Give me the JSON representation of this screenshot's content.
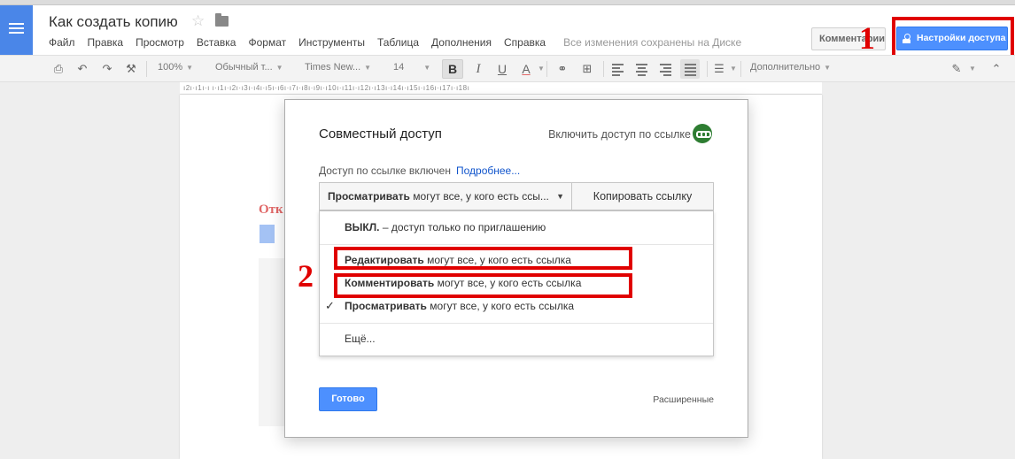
{
  "header": {
    "doc_title": "Как создать копию",
    "menu": [
      "Файл",
      "Правка",
      "Просмотр",
      "Вставка",
      "Формат",
      "Инструменты",
      "Таблица",
      "Дополнения",
      "Справка"
    ],
    "saved_status": "Все изменения сохранены на Диске",
    "comments_label": "Комментарии",
    "share_label": "Настройки доступа"
  },
  "toolbar": {
    "zoom": "100%",
    "style": "Обычный т...",
    "font": "Times New...",
    "size": "14",
    "bold": "B",
    "italic": "I",
    "underline": "U",
    "text_color": "A",
    "more": "Дополнительно"
  },
  "ruler": "ı2ı·ı1ı·ı ı·ı1ı·ı2ı·ı3ı·ı4ı·ı5ı·ı6ı·ı7ı·ı8ı·ı9ı·ı10ı·ı11ı·ı12ı·ı13ı·ı14ı·ı15ı·ı16ı·ı17ı·ı18ı",
  "page": {
    "heading": "Отк"
  },
  "dialog": {
    "title": "Совместный доступ",
    "link_toggle": "Включить доступ по ссылке",
    "link_status": "Доступ по ссылке включен",
    "learn_more": "Подробнее...",
    "select_bold": "Просматривать",
    "select_rest": " могут все, у кого есть ссы...",
    "copy_link": "Копировать ссылку",
    "options": [
      {
        "bold": "ВЫКЛ.",
        "rest": " – доступ только по приглашению",
        "checked": false
      },
      {
        "bold": "Редактировать",
        "rest": " могут все, у кого есть ссылка",
        "checked": false
      },
      {
        "bold": "Комментировать",
        "rest": " могут все, у кого есть ссылка",
        "checked": false
      },
      {
        "bold": "Просматривать",
        "rest": " могут все, у кого есть ссылка",
        "checked": true
      }
    ],
    "more": "Ещё...",
    "done": "Готово",
    "advanced": "Расширенные"
  },
  "annotations": {
    "one": "1",
    "two": "2"
  },
  "colors": {
    "accent": "#4d90fe",
    "annotation_red": "#e00000",
    "link_green": "#2e7d32",
    "heading_red": "#e06666"
  }
}
